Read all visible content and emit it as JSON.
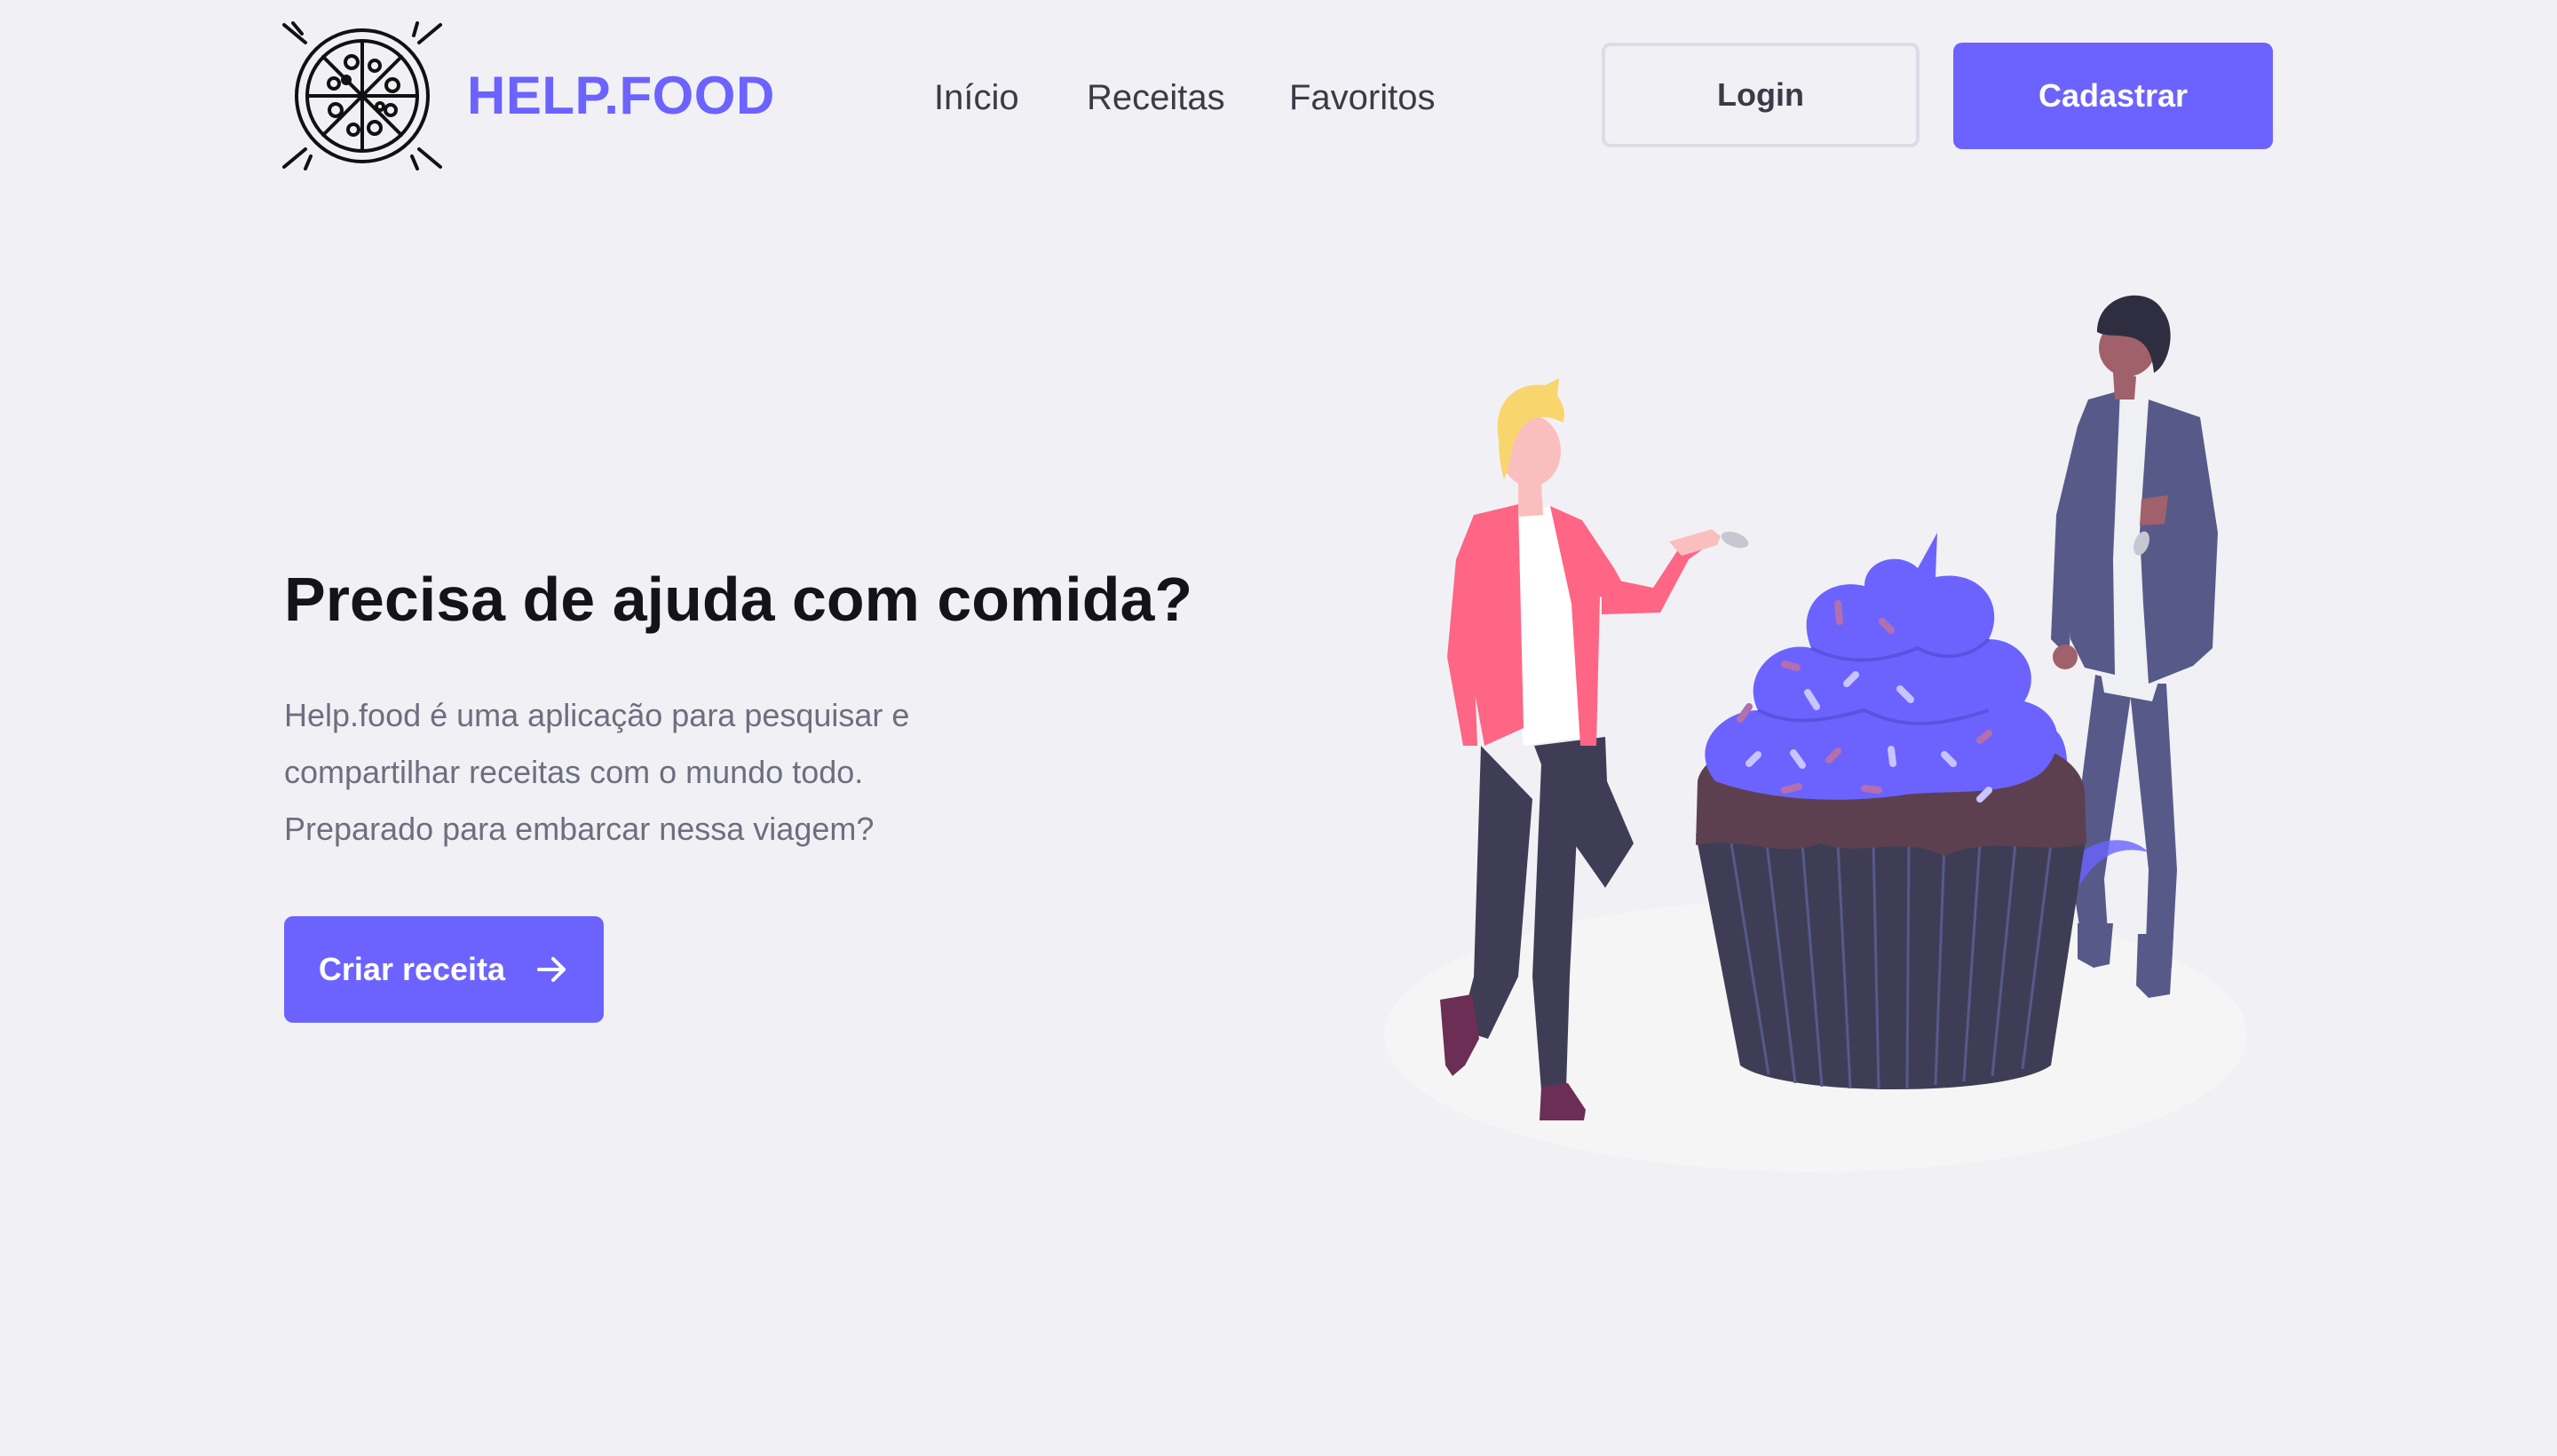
{
  "header": {
    "brand": "HELP.FOOD",
    "logo_icon": "pizza-icon",
    "nav": {
      "inicio": "Início",
      "receitas": "Receitas",
      "favoritos": "Favoritos"
    },
    "login_label": "Login",
    "signup_label": "Cadastrar"
  },
  "hero": {
    "title": "Precisa de ajuda com comida?",
    "description_lines": [
      "Help.food é uma aplicação para pesquisar e",
      "compartilhar receitas com o mundo todo.",
      "Preparado para embarcar nessa viagem?"
    ],
    "cta_label": "Criar receita",
    "cta_icon": "arrow-right-icon"
  },
  "illustration": {
    "name": "cupcake-people-illustration"
  },
  "colors": {
    "background": "#f1f1f5",
    "accent": "#6c63ff",
    "title": "#13131a",
    "text_muted": "#6e6e80",
    "nav_text": "#3b3b48"
  }
}
